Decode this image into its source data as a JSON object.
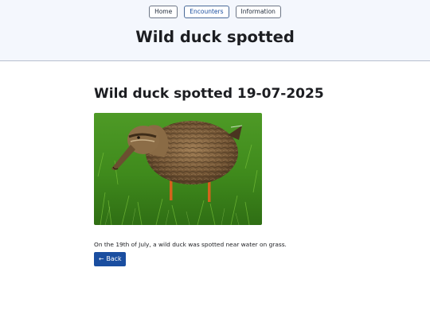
{
  "nav": {
    "home_label": "Home",
    "encounters_label": "Encounters",
    "information_label": "Information"
  },
  "header": {
    "title": "Wild duck spotted"
  },
  "main": {
    "heading": "Wild duck spotted 19-07-2025",
    "caption": "On the 19th of July, a wild duck was spotted near water on grass.",
    "back_arrow": "←",
    "back_label": "Back"
  },
  "colors": {
    "header_bg": "#f4f7fd",
    "accent": "#1a4ea0",
    "grass": "#3f8a1c"
  }
}
